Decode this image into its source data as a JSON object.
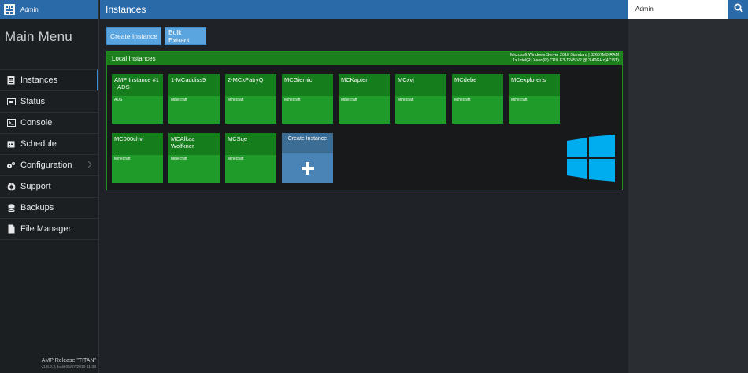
{
  "header": {
    "brand_label": "Admin",
    "page_title": "Instances",
    "user_name": "Admin"
  },
  "sidebar": {
    "menu_title": "Main Menu",
    "items": [
      {
        "label": "Instances",
        "icon": "file-icon",
        "active": true
      },
      {
        "label": "Status",
        "icon": "monitor-icon"
      },
      {
        "label": "Console",
        "icon": "console-icon"
      },
      {
        "label": "Schedule",
        "icon": "calendar-icon"
      },
      {
        "label": "Configuration",
        "icon": "gears-icon"
      },
      {
        "label": "Support",
        "icon": "lifebuoy-icon"
      },
      {
        "label": "Backups",
        "icon": "database-icon"
      },
      {
        "label": "File Manager",
        "icon": "document-icon"
      }
    ],
    "release_line1": "AMP Release \"TITAN\"",
    "release_line2": "v1.8.2.2, built 05/07/2019 11:38"
  },
  "toolbar": {
    "create_label": "Create Instance",
    "bulk_label": "Bulk Extract"
  },
  "panel": {
    "title": "Local Instances",
    "sysinfo_line1": "Microsoft Windows Server 2016 Standard | 32667MB RAM",
    "sysinfo_line2": "1x Intel(R) Xeon(R) CPU E3-1245 V2 @ 3.40GHz(4C/8T)"
  },
  "instances": [
    {
      "name": "AMP Instance #1 - ADS",
      "type": "ADS"
    },
    {
      "name": "1-MCaddiss9",
      "type": "Minecraft"
    },
    {
      "name": "2-MCxPatryQ",
      "type": "Minecraft"
    },
    {
      "name": "MCGiernic",
      "type": "Minecraft"
    },
    {
      "name": "MCKapten",
      "type": "Minecraft"
    },
    {
      "name": "MCxvj",
      "type": "Minecraft"
    },
    {
      "name": "MCdebe",
      "type": "Minecraft"
    },
    {
      "name": "MCexplorens",
      "type": "Minecraft"
    },
    {
      "name": "MC000chvj",
      "type": "Minecraft"
    },
    {
      "name": "MCAlkaa Wolfkner",
      "type": "Minecraft"
    },
    {
      "name": "MCSqe",
      "type": "Minecraft"
    }
  ],
  "create_tile": {
    "label": "Create Instance"
  },
  "colors": {
    "accent_blue": "#2b6aa8",
    "tile_green": "#1e9b28",
    "tile_green_dark": "#167d1d",
    "button_blue": "#5aa5e0",
    "create_tile_blue": "#4a84b6",
    "windows_blue": "#00adef"
  }
}
